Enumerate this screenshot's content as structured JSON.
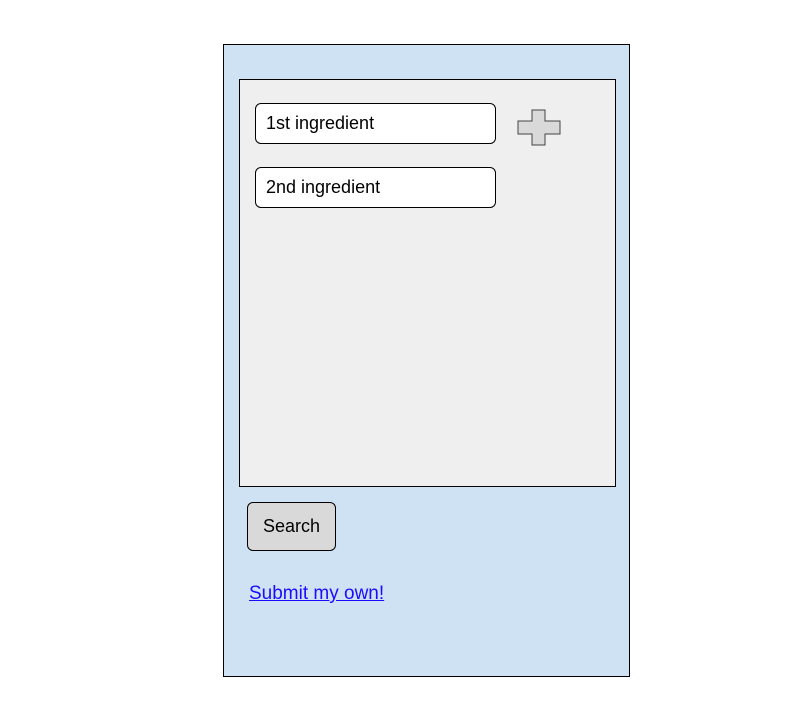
{
  "ingredients": {
    "items": [
      {
        "value": "1st ingredient"
      },
      {
        "value": "2nd ingredient"
      }
    ],
    "add_icon": "plus-icon"
  },
  "actions": {
    "search_label": "Search",
    "submit_link": "Submit my own!"
  },
  "colors": {
    "frame_background": "#cfe2f3",
    "panel_background": "#efefef",
    "button_background": "#d9d9d9",
    "link_color": "#1a0dff"
  }
}
